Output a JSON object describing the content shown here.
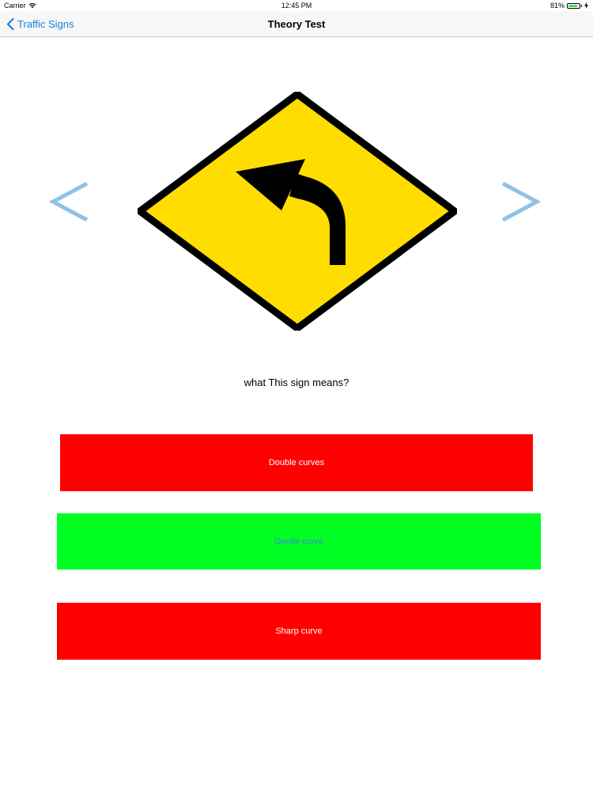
{
  "status_bar": {
    "carrier": "Carrier",
    "time": "12:45 PM",
    "battery_percent": "81%",
    "battery_level": 0.81
  },
  "nav": {
    "back_label": "Traffic Signs",
    "title": "Theory Test"
  },
  "sign": {
    "icon": "curve-left-warning-sign",
    "fill_color": "#ffdd00",
    "border_color": "#000000"
  },
  "arrows": {
    "color": "#8ec2e6"
  },
  "question": "what This sign means?",
  "answers": [
    {
      "label": "Double curves",
      "background": "#ff0000",
      "text_color": "#ffffff"
    },
    {
      "label": "Gentle curve",
      "background": "#00ff22",
      "text_color": "#3a8ad8"
    },
    {
      "label": "Sharp curve",
      "background": "#ff0000",
      "text_color": "#ffffff"
    }
  ],
  "colors": {
    "accent": "#1a82d8",
    "nav_background": "#f7f7f7"
  }
}
